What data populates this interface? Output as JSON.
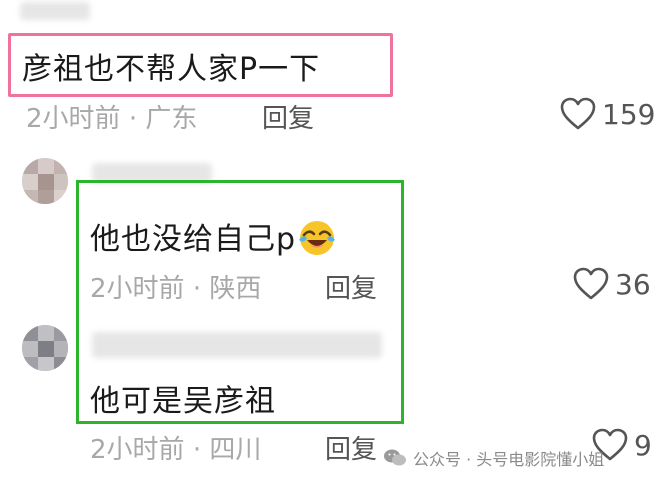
{
  "comments": [
    {
      "text": "彦祖也不帮人家P一下",
      "time": "2小时前",
      "separator": "·",
      "location": "广东",
      "reply_label": "回复",
      "likes": "159"
    },
    {
      "text": "他也没给自己p",
      "emoji": "crying-laughing-face",
      "time": "2小时前",
      "separator": "·",
      "location": "陕西",
      "reply_label": "回复",
      "likes": "36"
    },
    {
      "text": "他可是吴彦祖",
      "time": "2小时前",
      "separator": "·",
      "location": "四川",
      "reply_label": "回复",
      "likes": "9"
    }
  ],
  "watermark": {
    "text": "公众号 · 头号电影院懂小姐",
    "icon": "wechat-icon"
  },
  "colors": {
    "highlight_pink": "#f0739d",
    "highlight_green": "#2cb52c",
    "meta_gray": "#a8a8a8"
  }
}
